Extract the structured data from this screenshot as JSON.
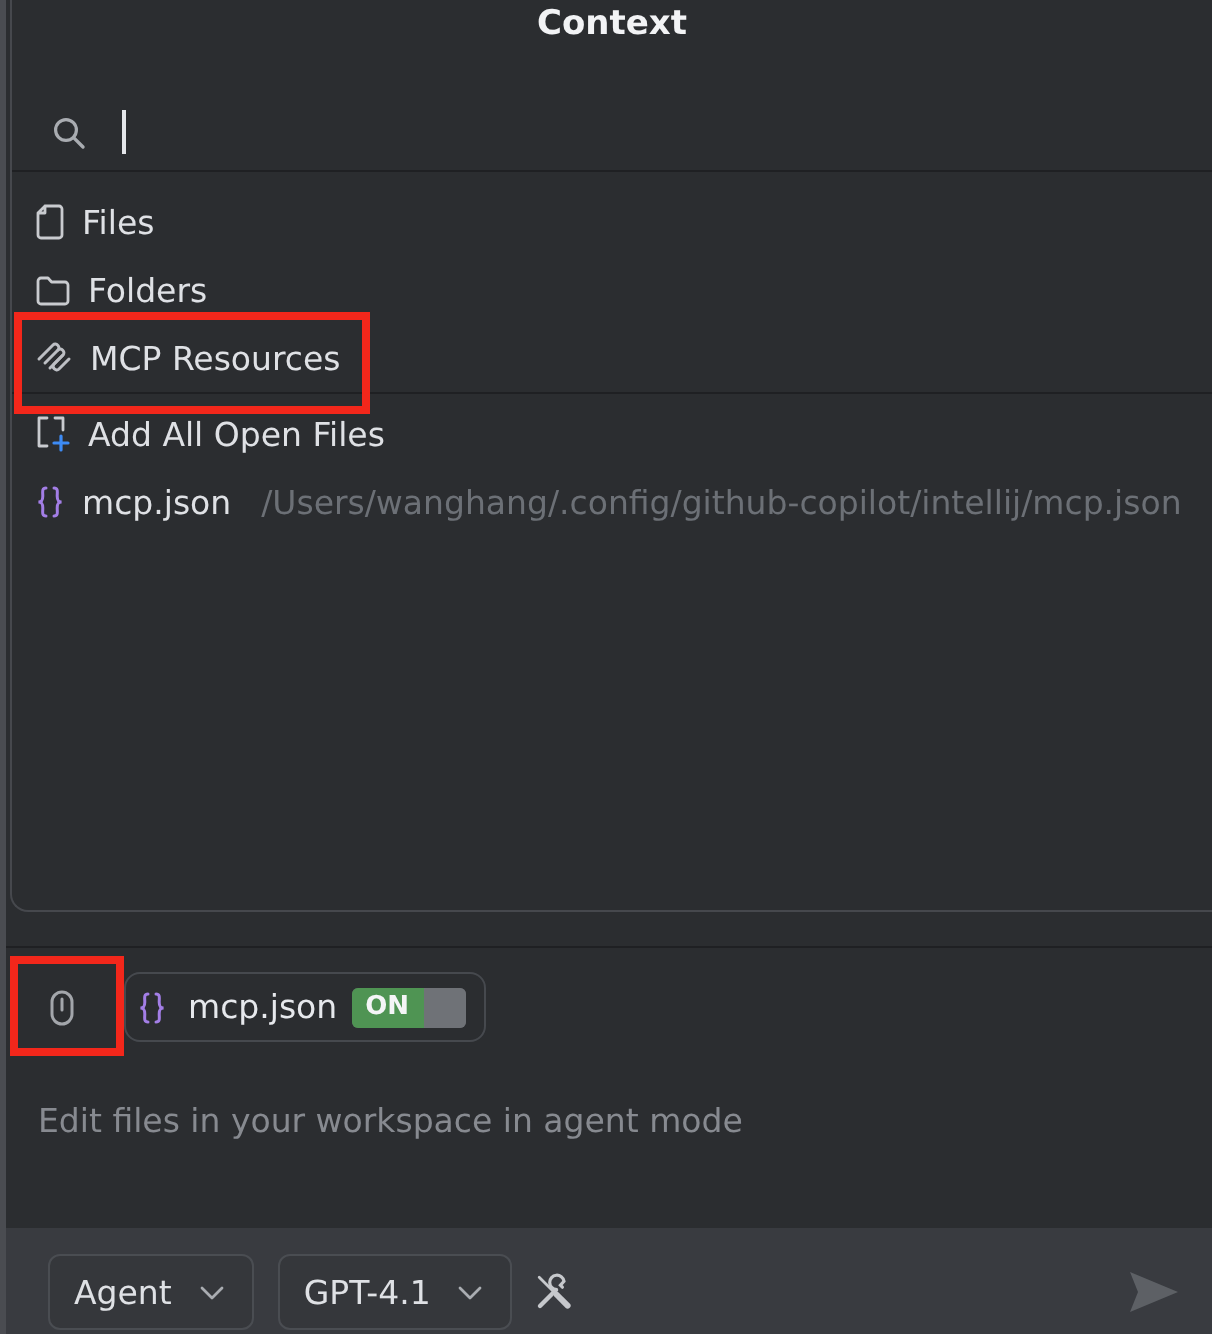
{
  "popup": {
    "title": "Context",
    "search": {
      "focused": true
    },
    "sections": [
      {
        "items": [
          {
            "kind": "file",
            "label": "Files",
            "highlighted": false
          },
          {
            "kind": "folder",
            "label": "Folders",
            "highlighted": false
          },
          {
            "kind": "mcp",
            "label": "MCP Resources",
            "highlighted": true
          }
        ]
      },
      {
        "items": [
          {
            "kind": "add_open_files",
            "label": "Add All Open Files",
            "highlighted": false
          },
          {
            "kind": "json",
            "label": "mcp.json",
            "path": "/Users/wanghang/.config/github-copilot/intellij/mcp.json",
            "highlighted": false
          }
        ]
      }
    ]
  },
  "input": {
    "attach_button": {
      "highlighted": true
    },
    "chips": [
      {
        "kind": "json",
        "label": "mcp.json",
        "toggle": {
          "label": "ON",
          "on": true
        }
      }
    ],
    "placeholder": "Edit files in your workspace in agent mode"
  },
  "toolbar": {
    "mode_dropdown": {
      "value": "Agent"
    },
    "model_dropdown": {
      "value": "GPT-4.1"
    },
    "send_button": {
      "disabled": true
    }
  }
}
